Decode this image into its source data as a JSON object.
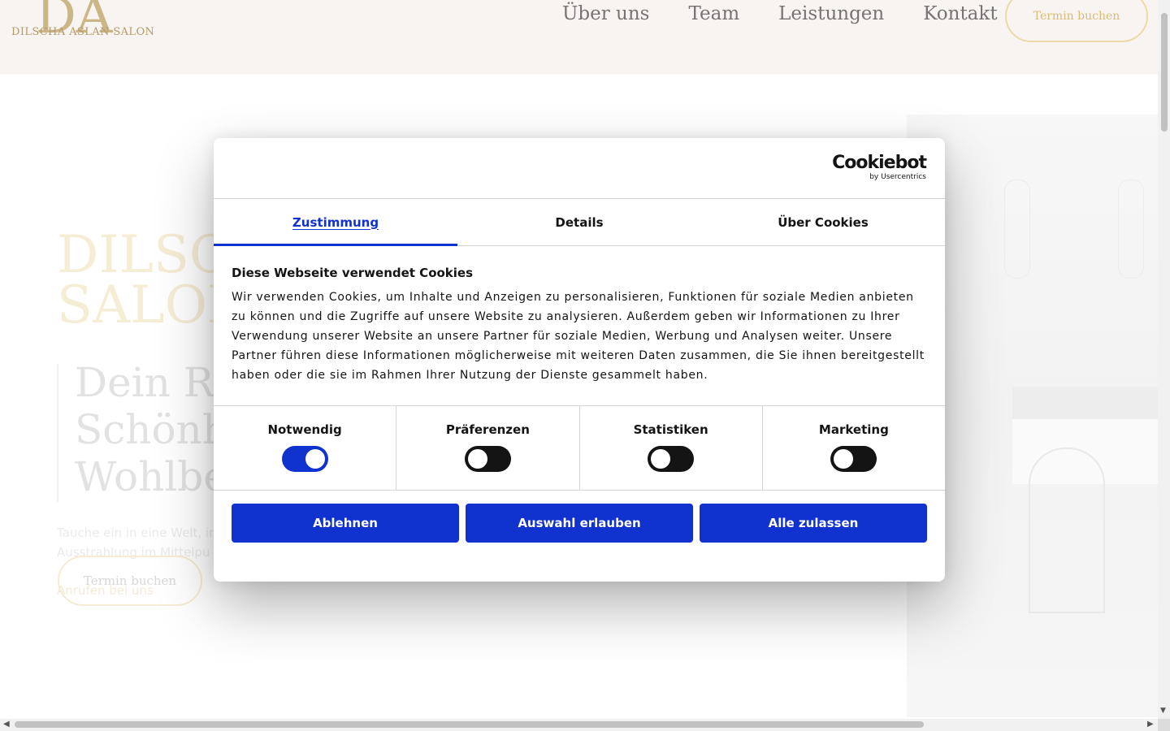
{
  "site": {
    "logo_mark": "DA",
    "logo_text": "DILSCHA ASLAN SALON",
    "nav": [
      "Über uns",
      "Team",
      "Leistungen",
      "Kontakt"
    ],
    "header_cta": "Termin buchen",
    "hero_title": "DILSC\nSALON",
    "hero_subtitle": "Dein Rü\nSchönhe\nWohlbef",
    "hero_text": "Tauche ein in eine Welt, in\nAusstrahlung im Mittelpu",
    "hero_cta": "Termin buchen",
    "hero_cta_sub": "Anrufen bei uns"
  },
  "cookie": {
    "brand_main": "Cookiebot",
    "brand_sub": "by Usercentrics",
    "tabs": [
      "Zustimmung",
      "Details",
      "Über Cookies"
    ],
    "active_tab": "Zustimmung",
    "heading": "Diese Webseite verwendet Cookies",
    "body": "Wir verwenden Cookies, um Inhalte und Anzeigen zu personalisieren, Funktionen für soziale Medien anbieten zu können und die Zugriffe auf unsere Website zu analysieren. Außerdem geben wir Informationen zu Ihrer Verwendung unserer Website an unsere Partner für soziale Medien, Werbung und Analysen weiter. Unsere Partner führen diese Informationen möglicherweise mit weiteren Daten zusammen, die Sie ihnen bereitgestellt haben oder die sie im Rahmen Ihrer Nutzung der Dienste gesammelt haben.",
    "toggles": [
      {
        "label": "Notwendig",
        "on": true
      },
      {
        "label": "Präferenzen",
        "on": false
      },
      {
        "label": "Statistiken",
        "on": false
      },
      {
        "label": "Marketing",
        "on": false
      }
    ],
    "buttons": {
      "reject": "Ablehnen",
      "allow_selection": "Auswahl erlauben",
      "allow_all": "Alle zulassen"
    }
  },
  "colors": {
    "accent": "#1032cf",
    "gold": "#c9b07a",
    "header_bg": "#f8f4f2",
    "text": "#141414"
  }
}
